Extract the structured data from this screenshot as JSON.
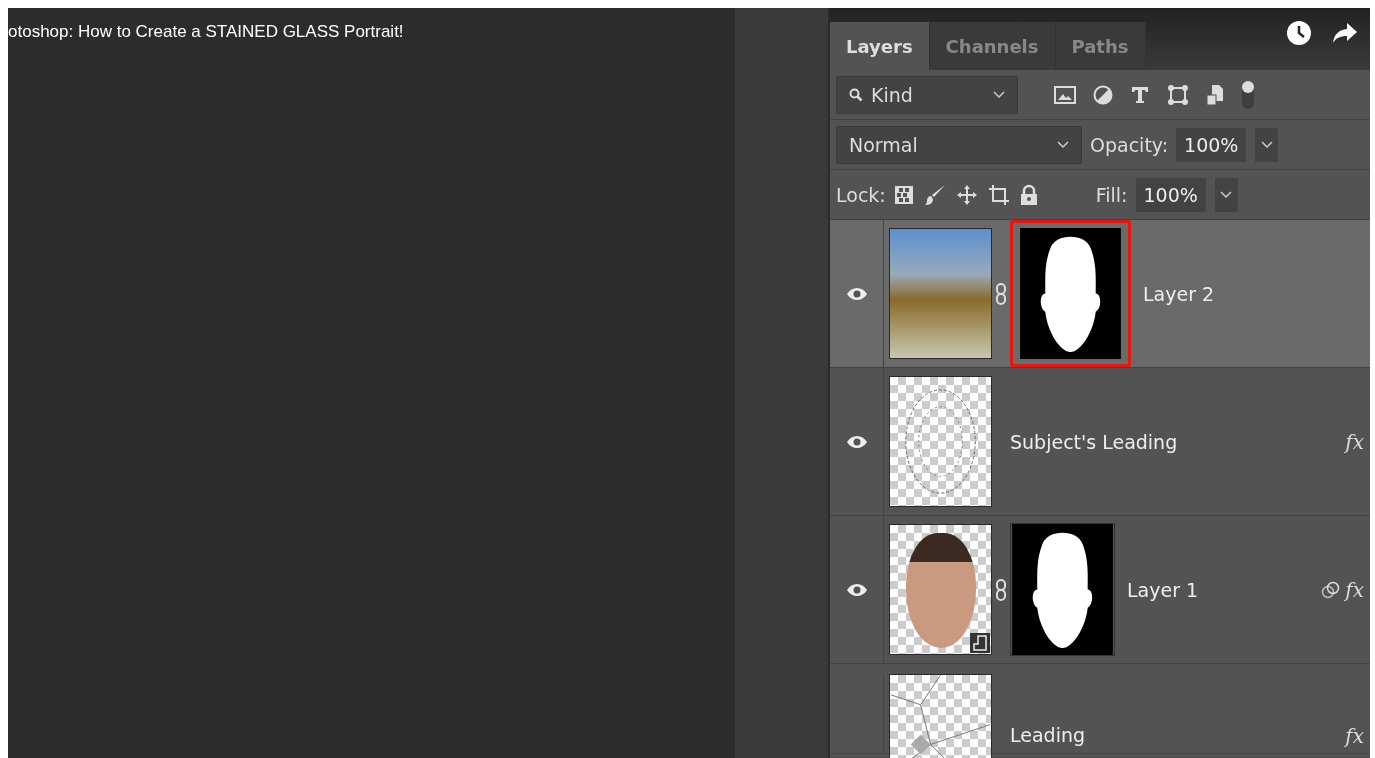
{
  "video": {
    "title": "otoshop: How to Create a STAINED GLASS Portrait!"
  },
  "panel": {
    "tabs": [
      {
        "label": "Layers",
        "selected": true
      },
      {
        "label": "Channels",
        "selected": false
      },
      {
        "label": "Paths",
        "selected": false
      }
    ],
    "filter": {
      "value": "Kind"
    },
    "blend_mode": {
      "value": "Normal"
    },
    "opacity": {
      "label": "Opacity:",
      "value": "100%"
    },
    "lock": {
      "label": "Lock:"
    },
    "fill": {
      "label": "Fill:",
      "value": "100%"
    },
    "layers": [
      {
        "name": "Layer 2",
        "visible": true,
        "selected": true,
        "kind": "photo",
        "mask": true,
        "mask_highlighted": true,
        "smart_object": false,
        "style_icon": false
      },
      {
        "name": "Subject's Leading",
        "visible": true,
        "selected": false,
        "kind": "lines",
        "mask": false,
        "mask_highlighted": false,
        "smart_object": false,
        "style_icon": false,
        "fx": "fx"
      },
      {
        "name": "Layer 1",
        "visible": true,
        "selected": false,
        "kind": "face",
        "mask": true,
        "mask_highlighted": false,
        "smart_object": true,
        "style_icon": true,
        "fx": "fx"
      },
      {
        "name": "Leading",
        "visible": false,
        "selected": false,
        "kind": "shards",
        "mask": false,
        "mask_highlighted": false,
        "smart_object": false,
        "style_icon": false,
        "fx": "fx"
      }
    ]
  }
}
